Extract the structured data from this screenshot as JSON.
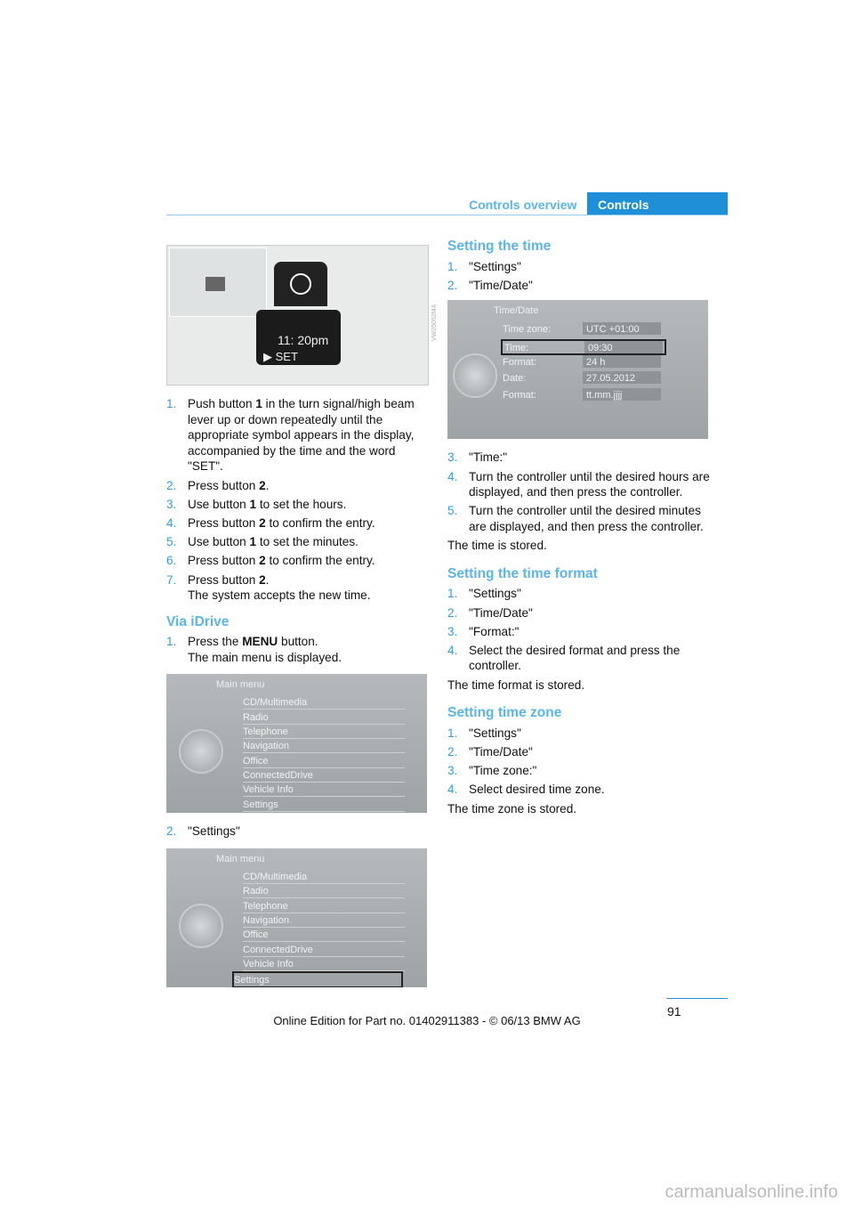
{
  "header": {
    "section": "Controls overview",
    "tab": "Controls"
  },
  "fig1": {
    "time": "11: 20pm",
    "set": "SET",
    "code": "VW25052MA"
  },
  "left": {
    "steps": [
      {
        "n": "1.",
        "pre": "Push button ",
        "b": "1",
        "post": " in the turn signal/high beam lever up or down repeatedly until the appropriate symbol appears in the display, accompanied by the time and the word \"SET\"."
      },
      {
        "n": "2.",
        "pre": "Press button ",
        "b": "2",
        "post": "."
      },
      {
        "n": "3.",
        "pre": "Use button ",
        "b": "1",
        "post": " to set the hours."
      },
      {
        "n": "4.",
        "pre": "Press button ",
        "b": "2",
        "post": " to confirm the entry."
      },
      {
        "n": "5.",
        "pre": "Use button ",
        "b": "1",
        "post": " to set the minutes."
      },
      {
        "n": "6.",
        "pre": "Press button ",
        "b": "2",
        "post": " to confirm the entry."
      },
      {
        "n": "7.",
        "pre": "Press button ",
        "b": "2",
        "post": ".",
        "extra": "The system accepts the new time."
      }
    ],
    "idrive_heading": "Via iDrive",
    "idrive_step1": {
      "n": "1.",
      "pre": "Press the ",
      "b": "MENU",
      "post": " button.",
      "extra": "The main menu is displayed."
    },
    "idrive_step2": {
      "n": "2.",
      "text": "\"Settings\""
    }
  },
  "menu": {
    "title": "Main menu",
    "items": [
      "CD/Multimedia",
      "Radio",
      "Telephone",
      "Navigation",
      "Office",
      "ConnectedDrive",
      "Vehicle Info",
      "Settings"
    ]
  },
  "right": {
    "time_heading": "Setting the time",
    "time_steps_a": [
      {
        "n": "1.",
        "text": "\"Settings\""
      },
      {
        "n": "2.",
        "text": "\"Time/Date\""
      }
    ],
    "timedate": {
      "title": "Time/Date",
      "rows": [
        {
          "label": "Time zone:",
          "value": "UTC +01:00"
        },
        {
          "label": "Time:",
          "value": "09:30"
        },
        {
          "label": "Format:",
          "value": "24 h"
        },
        {
          "label": "Date:",
          "value": "27.05.2012"
        },
        {
          "label": "Format:",
          "value": "tt.mm.jjjj"
        }
      ]
    },
    "time_steps_b": [
      {
        "n": "3.",
        "text": "\"Time:\""
      },
      {
        "n": "4.",
        "text": "Turn the controller until the desired hours are displayed, and then press the controller."
      },
      {
        "n": "5.",
        "text": "Turn the controller until the desired minutes are displayed, and then press the controller."
      }
    ],
    "time_stored": "The time is stored.",
    "format_heading": "Setting the time format",
    "format_steps": [
      {
        "n": "1.",
        "text": "\"Settings\""
      },
      {
        "n": "2.",
        "text": "\"Time/Date\""
      },
      {
        "n": "3.",
        "text": "\"Format:\""
      },
      {
        "n": "4.",
        "text": "Select the desired format and press the controller."
      }
    ],
    "format_stored": "The time format is stored.",
    "zone_heading": "Setting time zone",
    "zone_steps": [
      {
        "n": "1.",
        "text": "\"Settings\""
      },
      {
        "n": "2.",
        "text": "\"Time/Date\""
      },
      {
        "n": "3.",
        "text": "\"Time zone:\""
      },
      {
        "n": "4.",
        "text": "Select desired time zone."
      }
    ],
    "zone_stored": "The time zone is stored."
  },
  "footer": {
    "page": "91",
    "online": "Online Edition for Part no. 01402911383 - © 06/13 BMW AG",
    "watermark": "carmanualsonline.info"
  }
}
